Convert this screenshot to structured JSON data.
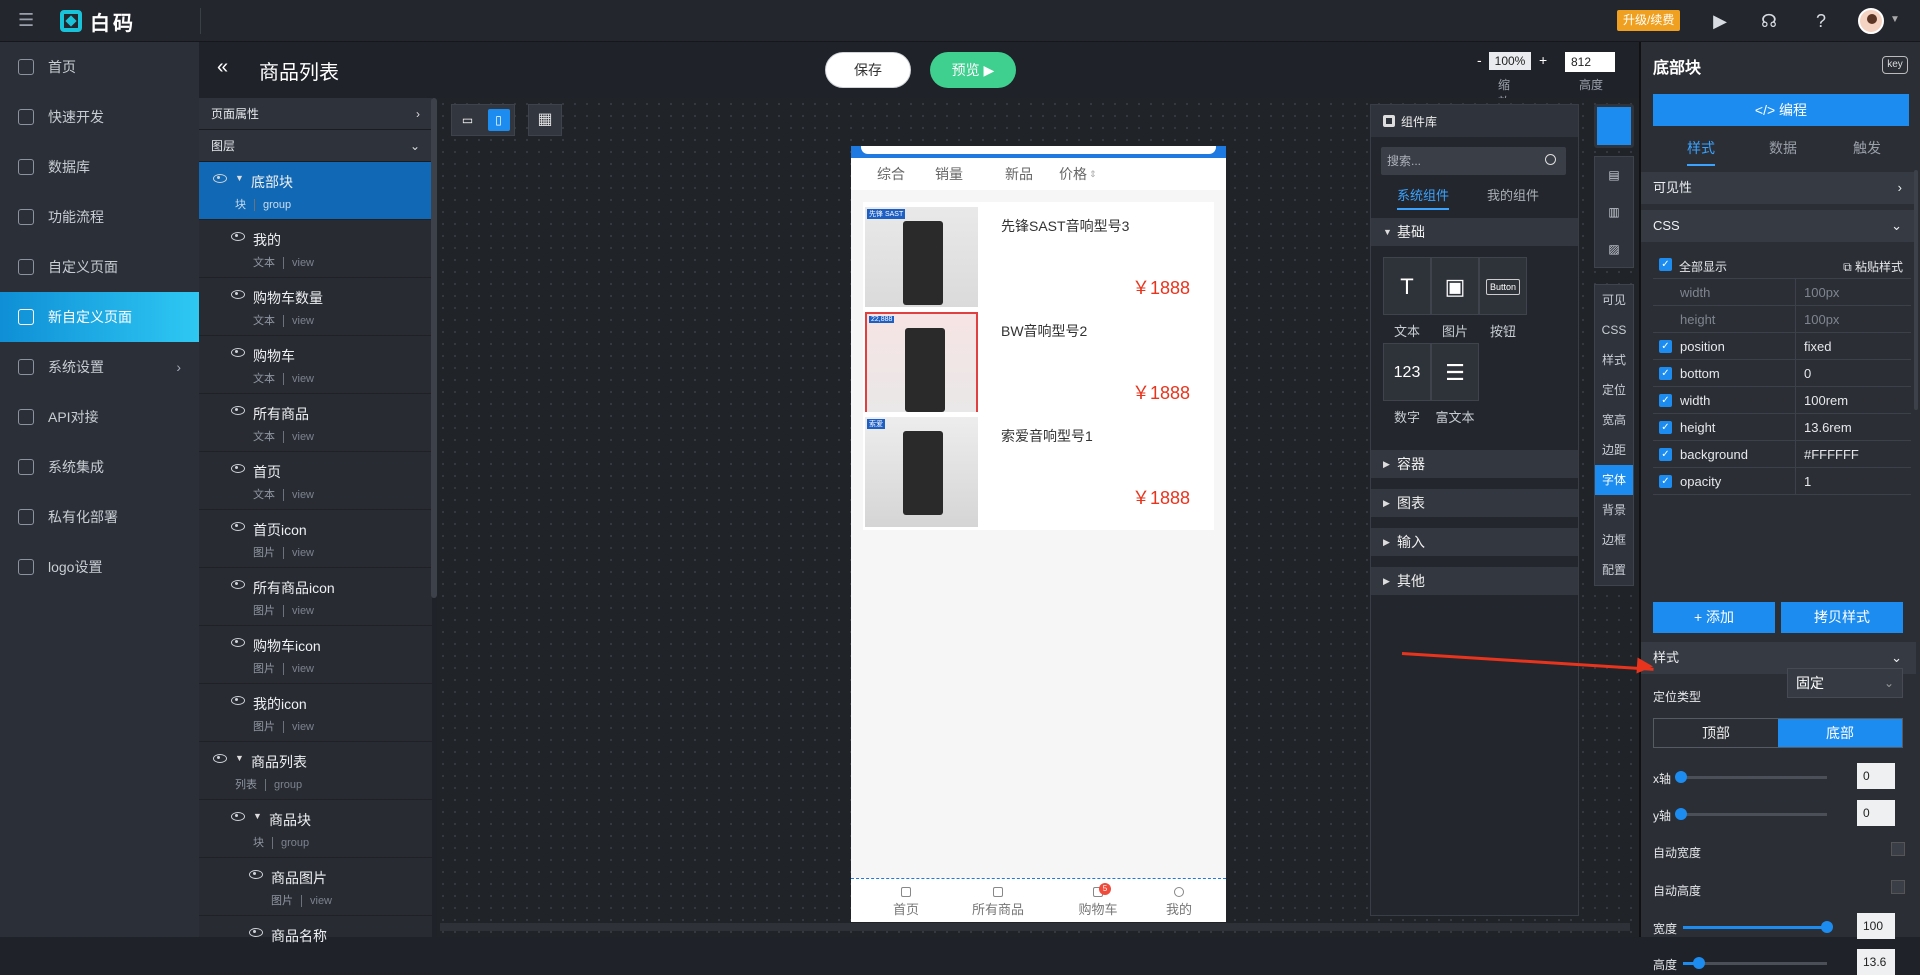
{
  "app": {
    "brand": "白码",
    "upgrade_label": "升级/续费"
  },
  "nav": {
    "items": [
      {
        "label": "首页"
      },
      {
        "label": "快速开发"
      },
      {
        "label": "数据库"
      },
      {
        "label": "功能流程"
      },
      {
        "label": "自定义页面"
      },
      {
        "label": "新自定义页面"
      },
      {
        "label": "系统设置"
      },
      {
        "label": "API对接"
      },
      {
        "label": "系统集成"
      },
      {
        "label": "私有化部署"
      },
      {
        "label": "logo设置"
      }
    ]
  },
  "page": {
    "title": "商品列表",
    "save_label": "保存",
    "preview_label": "预览"
  },
  "zoom": {
    "value": "100%",
    "label": "缩放",
    "minus": "-",
    "plus": "+"
  },
  "height_box": {
    "value": "812",
    "label": "高度"
  },
  "layers": {
    "page_props": "页面属性",
    "layers_title": "图层",
    "items": [
      {
        "name": "底部块",
        "type": "块",
        "kind": "group"
      },
      {
        "name": "我的",
        "type": "文本",
        "kind": "view"
      },
      {
        "name": "购物车数量",
        "type": "文本",
        "kind": "view"
      },
      {
        "name": "购物车",
        "type": "文本",
        "kind": "view"
      },
      {
        "name": "所有商品",
        "type": "文本",
        "kind": "view"
      },
      {
        "name": "首页",
        "type": "文本",
        "kind": "view"
      },
      {
        "name": "首页icon",
        "type": "图片",
        "kind": "view"
      },
      {
        "name": "所有商品icon",
        "type": "图片",
        "kind": "view"
      },
      {
        "name": "购物车icon",
        "type": "图片",
        "kind": "view"
      },
      {
        "name": "我的icon",
        "type": "图片",
        "kind": "view"
      },
      {
        "name": "商品列表",
        "type": "列表",
        "kind": "group"
      },
      {
        "name": "商品块",
        "type": "块",
        "kind": "group"
      },
      {
        "name": "商品图片",
        "type": "图片",
        "kind": "view"
      },
      {
        "name": "商品名称",
        "type": "",
        "kind": ""
      }
    ]
  },
  "phone": {
    "tabs": [
      "综合",
      "销量",
      "新品",
      "价格"
    ],
    "products": [
      {
        "name": "先锋SAST音响型号3",
        "price": "￥1888",
        "brand": "先锋 SAST"
      },
      {
        "name": "BW音响型号2",
        "price": "￥1888",
        "brand": "22,888"
      },
      {
        "name": "索爱音响型号1",
        "price": "￥1888",
        "brand": "索爱"
      }
    ],
    "bottom_nav": [
      {
        "label": "首页"
      },
      {
        "label": "所有商品"
      },
      {
        "label": "购物车"
      },
      {
        "label": "我的"
      }
    ],
    "cart_badge": "5"
  },
  "component_lib": {
    "title": "组件库",
    "search_placeholder": "搜索...",
    "tab_system": "系统组件",
    "tab_mine": "我的组件",
    "categories": {
      "basic": "基础",
      "container": "容器",
      "chart": "图表",
      "input": "输入",
      "other": "其他"
    },
    "basics": [
      {
        "glyph": "T",
        "label": "文本"
      },
      {
        "glyph": "▣",
        "label": "图片"
      },
      {
        "glyph": "Button",
        "label": "按钮"
      },
      {
        "glyph": "123",
        "label": "数字"
      },
      {
        "glyph": "☰",
        "label": "富文本"
      }
    ]
  },
  "side_tools": [
    "可见",
    "CSS",
    "样式",
    "定位",
    "宽高",
    "边距",
    "字体",
    "背景",
    "边框",
    "配置"
  ],
  "props": {
    "title": "底部块",
    "key_label": "key",
    "edit_label": "</> 编程",
    "tabs": [
      "样式",
      "数据",
      "触发"
    ],
    "visibility": "可见性",
    "css": "CSS",
    "show_all": "全部显示",
    "paste_style": "粘贴样式",
    "rows": [
      {
        "k": "width",
        "v": "100px",
        "on": false
      },
      {
        "k": "height",
        "v": "100px",
        "on": false
      },
      {
        "k": "position",
        "v": "fixed",
        "on": true
      },
      {
        "k": "bottom",
        "v": "0",
        "on": true
      },
      {
        "k": "width",
        "v": "100rem",
        "on": true
      },
      {
        "k": "height",
        "v": "13.6rem",
        "on": true
      },
      {
        "k": "background",
        "v": "#FFFFFF",
        "on": true
      },
      {
        "k": "opacity",
        "v": "1",
        "on": true
      }
    ],
    "add_label": "+ 添加",
    "copy_label": "拷贝样式",
    "style_section": "样式",
    "pos_type_label": "定位类型",
    "pos_type_value": "固定",
    "seg_top": "顶部",
    "seg_bottom": "底部",
    "x_label": "x轴",
    "x_value": "0",
    "y_label": "y轴",
    "y_value": "0",
    "auto_width": "自动宽度",
    "auto_height": "自动高度",
    "width_label": "宽度",
    "width_value": "100",
    "height_label": "高度",
    "height_value": "13.6"
  }
}
